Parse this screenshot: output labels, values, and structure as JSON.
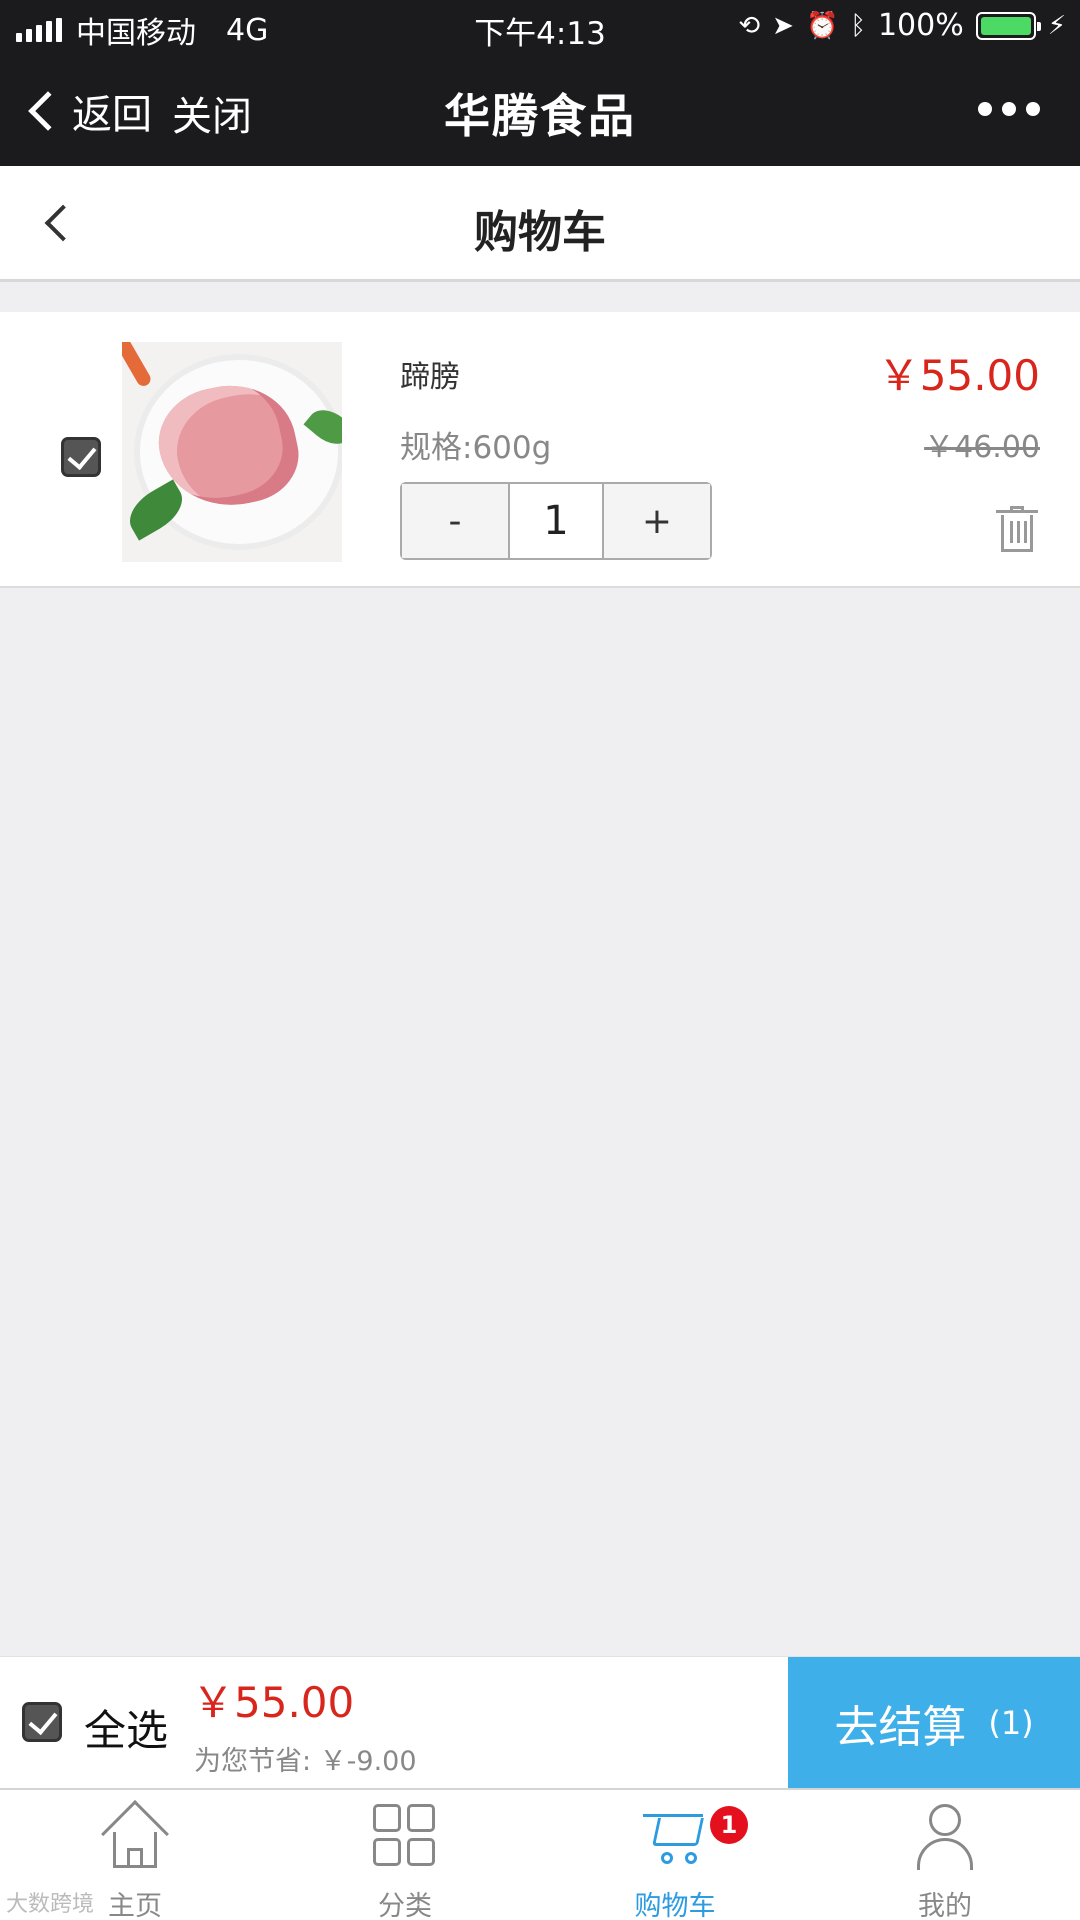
{
  "status_bar": {
    "carrier": "中国移动",
    "network": "4G",
    "time": "下午4:13",
    "battery": "100%"
  },
  "wechat_nav": {
    "back_label": "返回",
    "close_label": "关闭",
    "title": "华腾食品"
  },
  "page": {
    "title": "购物车"
  },
  "cart_item": {
    "name": "蹄膀",
    "spec": "规格:600g",
    "price": "￥55.00",
    "original_price": "￥46.00",
    "quantity": "1",
    "minus_label": "-",
    "plus_label": "+",
    "checked": true
  },
  "checkout": {
    "select_all_label": "全选",
    "total": "￥55.00",
    "savings": "为您节省: ￥-9.00",
    "pay_label": "去结算",
    "pay_count": "(1)"
  },
  "tabbar": {
    "items": [
      {
        "label": "主页",
        "icon": "home-icon"
      },
      {
        "label": "分类",
        "icon": "grid-icon"
      },
      {
        "label": "购物车",
        "icon": "cart-icon",
        "badge": "1",
        "active": true
      },
      {
        "label": "我的",
        "icon": "user-icon"
      }
    ]
  },
  "watermark": "大数跨境",
  "colors": {
    "accent": "#3eafe9",
    "price_red": "#d9261c",
    "badge_red": "#e5101d",
    "active_tab": "#2c9be0"
  }
}
